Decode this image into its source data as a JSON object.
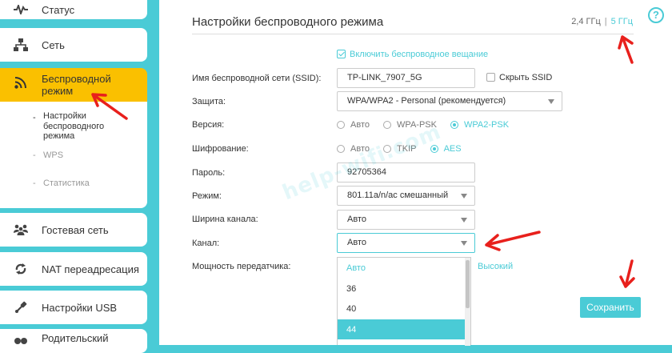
{
  "colors": {
    "accent": "#4acbd6",
    "active_nav": "#fac000",
    "arrow": "#e8201c"
  },
  "sidebar": {
    "items": [
      {
        "label": "Статус",
        "icon": "pulse-icon"
      },
      {
        "label": "Сеть",
        "icon": "network-icon"
      },
      {
        "label": "Беспроводной режим",
        "icon": "wifi-icon"
      },
      {
        "label": "Гостевая сеть",
        "icon": "guests-icon"
      },
      {
        "label": "NAT переадресация",
        "icon": "nat-icon"
      },
      {
        "label": "Настройки USB",
        "icon": "usb-icon"
      },
      {
        "label": "Родительский",
        "icon": "parental-icon"
      }
    ],
    "sub_items": [
      {
        "label": "Настройки беспроводного режима"
      },
      {
        "label": "WPS"
      },
      {
        "label": "Статистика"
      }
    ]
  },
  "header": {
    "title": "Настройки беспроводного режима",
    "band_24": "2,4 ГГц",
    "band_sep": "|",
    "band_5": "5 ГГц",
    "help": "?"
  },
  "form": {
    "broadcast_label": "Включить беспроводное вещание",
    "broadcast_checked": true,
    "ssid_label": "Имя беспроводной сети (SSID):",
    "ssid_value": "TP-LINK_7907_5G",
    "hide_ssid_label": "Скрыть SSID",
    "hide_ssid_checked": false,
    "security_label": "Защита:",
    "security_value": "WPA/WPA2 - Personal (рекомендуется)",
    "version_label": "Версия:",
    "version_options": [
      "Авто",
      "WPA-PSK",
      "WPA2-PSK"
    ],
    "version_selected": "WPA2-PSK",
    "encryption_label": "Шифрование:",
    "encryption_options": [
      "Авто",
      "TKIP",
      "AES"
    ],
    "encryption_selected": "AES",
    "password_label": "Пароль:",
    "password_value": "92705364",
    "mode_label": "Режим:",
    "mode_value": "801.11a/n/ac смешанный",
    "width_label": "Ширина канала:",
    "width_value": "Авто",
    "channel_label": "Канал:",
    "channel_value": "Авто",
    "power_label": "Мощность передатчика:",
    "power_value": "Высокий",
    "channel_options": [
      "Авто",
      "36",
      "40",
      "44"
    ],
    "channel_option_selected": "Авто",
    "channel_option_highlighted": "44"
  },
  "save_label": "Сохранить",
  "watermark": "help-wifi.com"
}
